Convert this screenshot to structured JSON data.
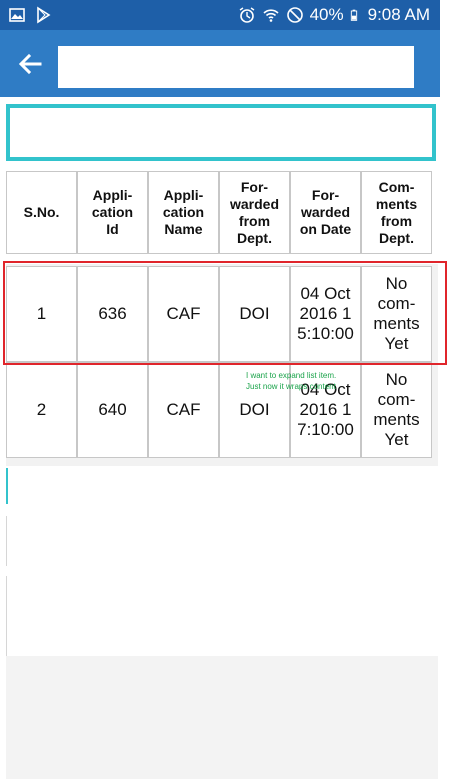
{
  "status_bar": {
    "battery": "40%",
    "time": "9:08 AM",
    "left_icons": [
      "image-icon",
      "play-store-icon"
    ],
    "right_icons": [
      "alarm-icon",
      "wifi-icon",
      "no-disturb-icon",
      "battery-icon"
    ]
  },
  "app_bar": {
    "back_icon": "arrow-left-icon",
    "title": ""
  },
  "search": {
    "value": ""
  },
  "table": {
    "headers": [
      "S.No.",
      "Appli-\ncation\nId",
      "Appli-\ncation\nName",
      "For-\nwarded\nfrom\nDept.",
      "For-\nwarded\non Date",
      "Com-\nments\nfrom\nDept."
    ],
    "rows": [
      [
        "1",
        "636",
        "CAF",
        "DOI",
        "04 Oct\n2016 1\n5:10:00",
        "No\ncom-\nments\nYet"
      ],
      [
        "2",
        "640",
        "CAF",
        "DOI",
        "04 Oct\n2016 1\n7:10:00",
        "No\ncom-\nments\nYet"
      ]
    ]
  },
  "annotation": "I want to expand list item. Just now it wraps content",
  "colors": {
    "status_bar": "#1e5fa8",
    "app_bar": "#2f7cc5",
    "search_border": "#32c3cc",
    "highlight": "#e0252b",
    "annotation": "#1aa34a"
  }
}
